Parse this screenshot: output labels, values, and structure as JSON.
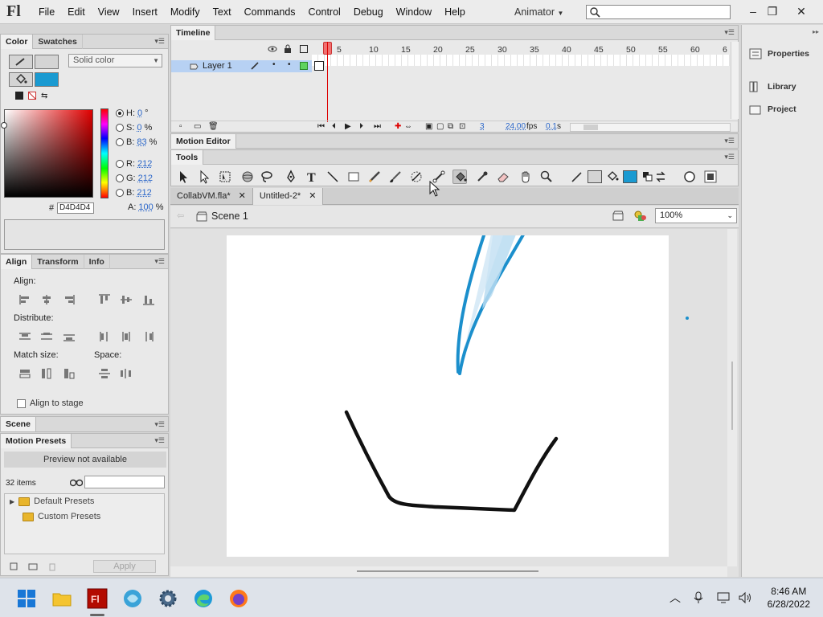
{
  "menubar": {
    "logo": "Fl",
    "items": [
      "File",
      "Edit",
      "View",
      "Insert",
      "Modify",
      "Text",
      "Commands",
      "Control",
      "Debug",
      "Window",
      "Help"
    ],
    "workspace": "Animator"
  },
  "color_panel": {
    "tabs": [
      "Color",
      "Swatches"
    ],
    "fill_type": "Solid color",
    "hsb": [
      {
        "label": "H:",
        "value": "0",
        "unit": "°"
      },
      {
        "label": "S:",
        "value": "0",
        "unit": "%"
      },
      {
        "label": "B:",
        "value": "83",
        "unit": "%"
      }
    ],
    "rgb": [
      {
        "label": "R:",
        "value": "212"
      },
      {
        "label": "G:",
        "value": "212"
      },
      {
        "label": "B:",
        "value": "212"
      }
    ],
    "alpha": {
      "label": "A:",
      "value": "100",
      "unit": "%"
    },
    "hex_label": "#",
    "hex": "D4D4D4",
    "fill_color": "#1a9ad1"
  },
  "align_panel": {
    "tabs": [
      "Align",
      "Transform",
      "Info"
    ],
    "align_label": "Align:",
    "distribute_label": "Distribute:",
    "match_size_label": "Match size:",
    "space_label": "Space:",
    "align_to_stage": "Align to stage"
  },
  "scene_panel": {
    "title": "Scene"
  },
  "presets_panel": {
    "title": "Motion Presets",
    "preview": "Preview not available",
    "count": "32 items",
    "items": [
      "Default Presets",
      "Custom Presets"
    ],
    "apply": "Apply"
  },
  "timeline": {
    "title": "Timeline",
    "layer_name": "Layer 1",
    "frame_numbers": [
      "5",
      "10",
      "15",
      "20",
      "25",
      "30",
      "35",
      "40",
      "45",
      "50",
      "55",
      "60",
      "6"
    ],
    "current_frame": "3",
    "fps": "24.00",
    "fps_unit": "fps",
    "time": "0.1",
    "time_unit": "s"
  },
  "motion_editor": {
    "title": "Motion Editor"
  },
  "tools": {
    "title": "Tools"
  },
  "documents": {
    "tabs": [
      "CollabVM.fla*",
      "Untitled-2*"
    ],
    "active": 1,
    "scene": "Scene 1",
    "zoom": "100%"
  },
  "right_dock": {
    "items": [
      "Properties",
      "Library",
      "Project"
    ]
  },
  "taskbar": {
    "time": "8:46 AM",
    "date": "6/28/2022"
  }
}
